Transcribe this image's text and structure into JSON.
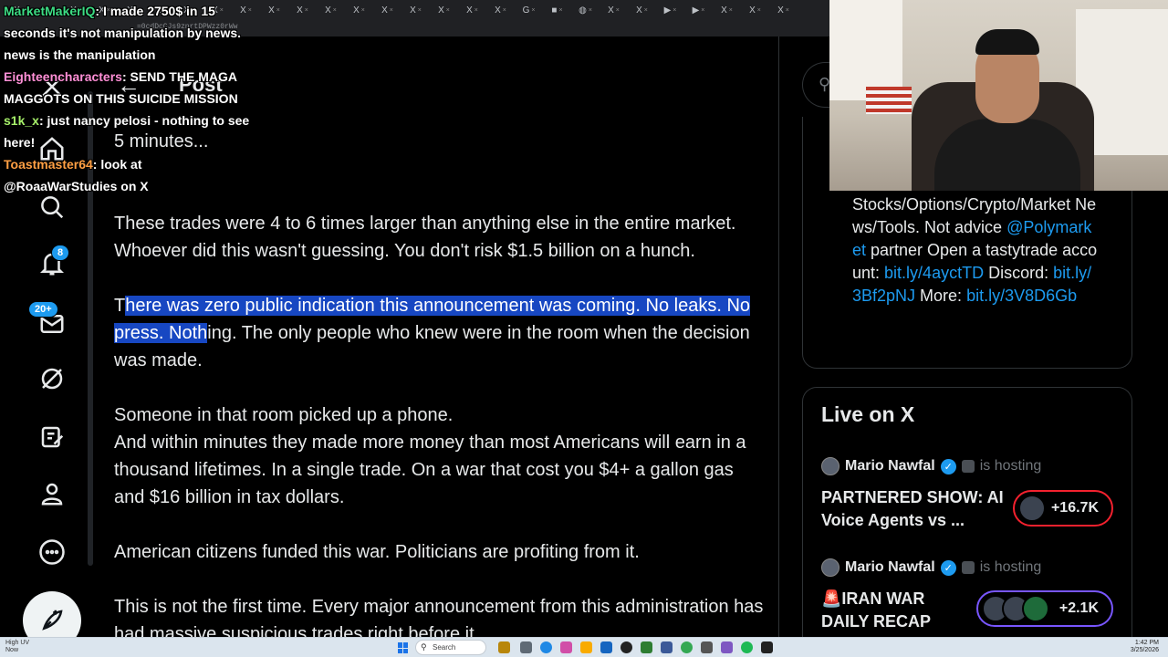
{
  "browser": {
    "tabs": [
      {
        "icon": "x-logo",
        "label": "X"
      },
      {
        "icon": "x-logo",
        "label": "X"
      },
      {
        "icon": "x-logo",
        "label": "X"
      },
      {
        "icon": "x-logo",
        "label": "X"
      },
      {
        "icon": "x-logo",
        "label": "X"
      },
      {
        "icon": "x-logo",
        "label": "X"
      },
      {
        "icon": "x-logo",
        "label": "X"
      },
      {
        "icon": "x-logo",
        "label": "X"
      },
      {
        "icon": "x-logo",
        "label": "X"
      },
      {
        "icon": "x-logo",
        "label": "X"
      },
      {
        "icon": "x-logo",
        "label": "X"
      },
      {
        "icon": "x-logo",
        "label": "X"
      },
      {
        "icon": "x-logo",
        "label": "X"
      },
      {
        "icon": "x-logo",
        "label": "X"
      },
      {
        "icon": "x-logo",
        "label": "X"
      },
      {
        "icon": "x-logo",
        "label": "X"
      },
      {
        "icon": "x-logo",
        "label": "X"
      },
      {
        "icon": "x-logo",
        "label": "X"
      },
      {
        "icon": "google-icon",
        "label": "G"
      },
      {
        "icon": "green-icon",
        "label": "■"
      },
      {
        "icon": "globe-icon",
        "label": "◍"
      },
      {
        "icon": "x-logo",
        "label": "X"
      },
      {
        "icon": "x-logo",
        "label": "X"
      },
      {
        "icon": "youtube-icon",
        "label": "▶"
      },
      {
        "icon": "youtube-icon",
        "label": "▶"
      },
      {
        "icon": "x-logo",
        "label": "X"
      },
      {
        "icon": "x-logo",
        "label": "X"
      },
      {
        "icon": "x-logo",
        "label": "X"
      }
    ],
    "url_fragment": "=0cdDcCJs9znrtDPWzz0rWw"
  },
  "chat": [
    {
      "user": "MarketMakerIQ",
      "color": "#3ddc84",
      "message": "I made 2750$ in 15 seconds it's not manipulation by news. news is the manipulation"
    },
    {
      "user": "Eighteencharacters",
      "color": "#ff8fd6",
      "message": "SEND THE MAGA MAGGOTS ON THIS SUICIDE MISSION"
    },
    {
      "user": "s1k_x",
      "color": "#a6f06a",
      "message": "just nancy pelosi - nothing to see here!"
    },
    {
      "user": "Toastmaster64",
      "color": "#ff9f43",
      "message": "look at @RoaaWarStudies on X"
    }
  ],
  "nav": {
    "items": [
      {
        "name": "x-logo-icon",
        "label": "X"
      },
      {
        "name": "home-icon",
        "label": "Home"
      },
      {
        "name": "search-icon",
        "label": "Explore"
      },
      {
        "name": "bell-icon",
        "label": "Notifications"
      },
      {
        "name": "mail-icon",
        "label": "Messages"
      },
      {
        "name": "grok-icon",
        "label": "Grok"
      },
      {
        "name": "compose-note-icon",
        "label": "Articles"
      },
      {
        "name": "person-icon",
        "label": "Profile"
      },
      {
        "name": "more-icon",
        "label": "More"
      }
    ],
    "notif_count": "8",
    "messages_count": "20+"
  },
  "header": {
    "title": "Post",
    "back": "←"
  },
  "tweet": {
    "lead": "5 minutes...",
    "p1": "These trades were 4 to 6 times larger than anything else in the entire market. Whoever did this wasn't guessing. You don't risk $1.5 billion on a hunch.",
    "p2_pre": "T",
    "p2_highlight": "here was zero public indication this announcement was coming. No leaks. No press. Noth",
    "p2_post": "ing. The only people who knew were in the room when the decision was made.",
    "p3a": "Someone in that room picked up a phone.",
    "p3b": "And within minutes they made more money than most Americans will earn in a thousand lifetimes. In a single trade. On a war that cost you $4+ a gallon gas and $16 billion in tax dollars.",
    "p4": "American citizens funded this war. Politicians are profiting from it.",
    "p5": "This is not the first time. Every major announcement from this administration has had massive suspicious trades right before it."
  },
  "bio": {
    "text": "Stocks/Options/Crypto/Market News/Tools. Not advice",
    "mention": "@Polymarket",
    "after_mention": " partner Open a tastytrade account:",
    "link1": "bit.ly/4ayctTD",
    "discord": " Discord:",
    "link2": "bit.ly/3Bf2pNJ",
    "more": " More:",
    "link3": "bit.ly/3V8D6Gb"
  },
  "live": {
    "title": "Live on X",
    "spaces": [
      {
        "host": "Mario Nawfal",
        "status": "is hosting",
        "title": "PARTNERED SHOW: AI Voice Agents vs ...",
        "count": "+16.7K",
        "accent": "#f4212e"
      },
      {
        "host": "Mario Nawfal",
        "status": "is hosting",
        "title": "🚨IRAN WAR DAILY RECAP",
        "count": "+2.1K",
        "accent": "#7856ff"
      }
    ]
  },
  "taskbar": {
    "weather_temp": "High UV",
    "weather_sub": "Now",
    "search_placeholder": "Search",
    "time": "1:42 PM",
    "date": "3/25/2026"
  }
}
